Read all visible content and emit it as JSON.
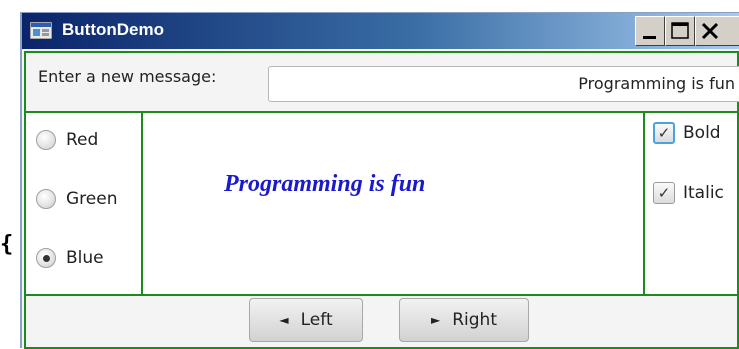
{
  "stray_glyph": "{",
  "window": {
    "title": "ButtonDemo"
  },
  "titlebar_buttons": {
    "minimize": "_",
    "maximize": "□",
    "close": "X"
  },
  "input": {
    "label": "Enter a new message:",
    "value": "Programming is fun"
  },
  "message_text": "Programming is fun",
  "radios": [
    {
      "label": "Red",
      "selected": false
    },
    {
      "label": "Green",
      "selected": false
    },
    {
      "label": "Blue",
      "selected": true
    }
  ],
  "checkboxes": [
    {
      "label": "Bold",
      "checked": true
    },
    {
      "label": "Italic",
      "checked": true
    }
  ],
  "buttons": {
    "left": "Left",
    "right": "Right"
  },
  "colors": {
    "message": "#1a1acc",
    "pane_border": "#1c8a1c",
    "titlebar": "#0a246a"
  },
  "icons": {
    "checkmark": "✓",
    "left_arrow": "◄",
    "right_arrow": "►"
  }
}
